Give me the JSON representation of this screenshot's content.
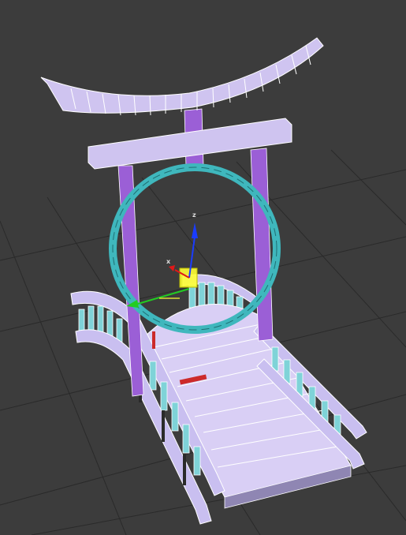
{
  "viewport": {
    "background_color": "#3c3c3c",
    "grid_color": "#2a2a2a"
  },
  "model": {
    "torii": {
      "face_color": "#cfc4f0",
      "edge_color": "#ffffff",
      "pillar_color": "#9b5fd6"
    },
    "ring": {
      "color": "#3fb7bd"
    },
    "bridge": {
      "deck_color": "#d9cff5",
      "rail_color": "#c9bff0",
      "baluster_fill_color": "#7fd3d8",
      "shadow_color": "#2a2a2a"
    }
  },
  "gizmo": {
    "z_label": "z",
    "x_label": "x",
    "z_color": "#1a3cff",
    "x_color": "#e01818",
    "y_color": "#22cc22",
    "plane_color": "#ffff33"
  }
}
